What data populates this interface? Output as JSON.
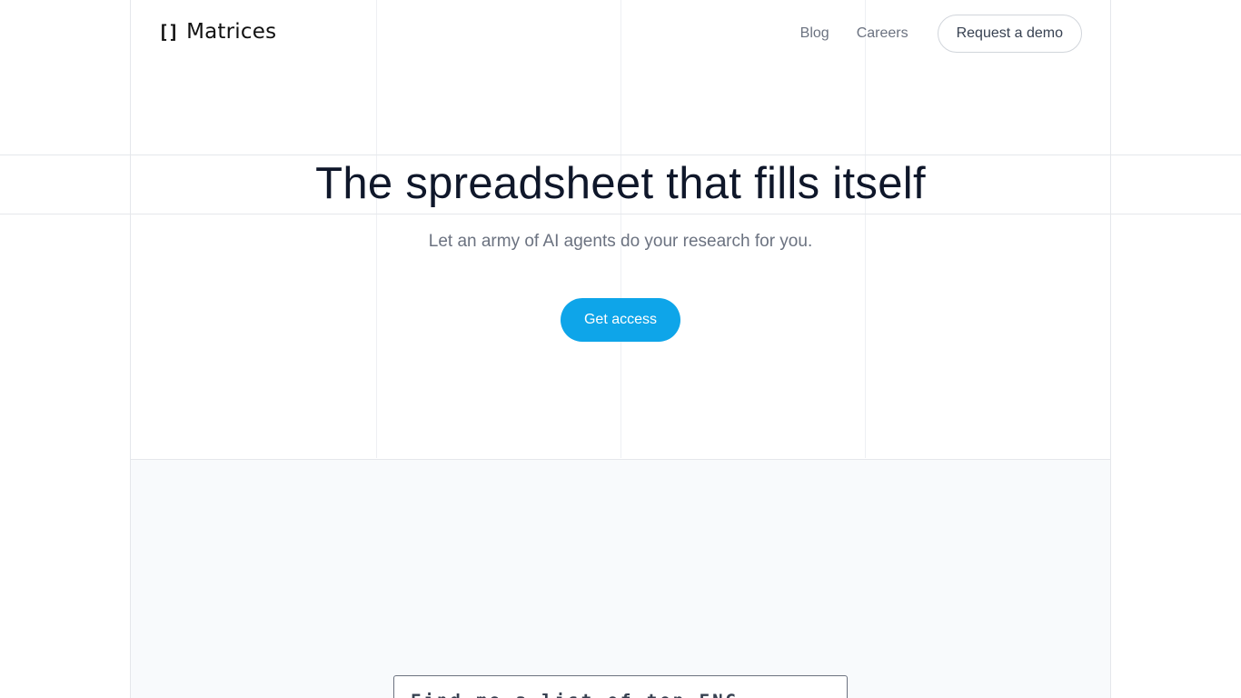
{
  "header": {
    "logo_mark": "[]",
    "logo_text": "Matrices",
    "nav": {
      "blog": "Blog",
      "careers": "Careers",
      "demo_button": "Request a demo"
    }
  },
  "hero": {
    "title": "The spreadsheet that fills itself",
    "subtitle": "Let an army of AI agents do your research for you.",
    "cta": "Get access"
  },
  "demo": {
    "prompt_text": "Find me a list of top ENG..."
  },
  "colors": {
    "accent": "#0ea5e9",
    "title": "#0f172a",
    "muted": "#6b7280",
    "panel_bg": "#f8fafc",
    "grid_line": "#e5e7eb"
  }
}
